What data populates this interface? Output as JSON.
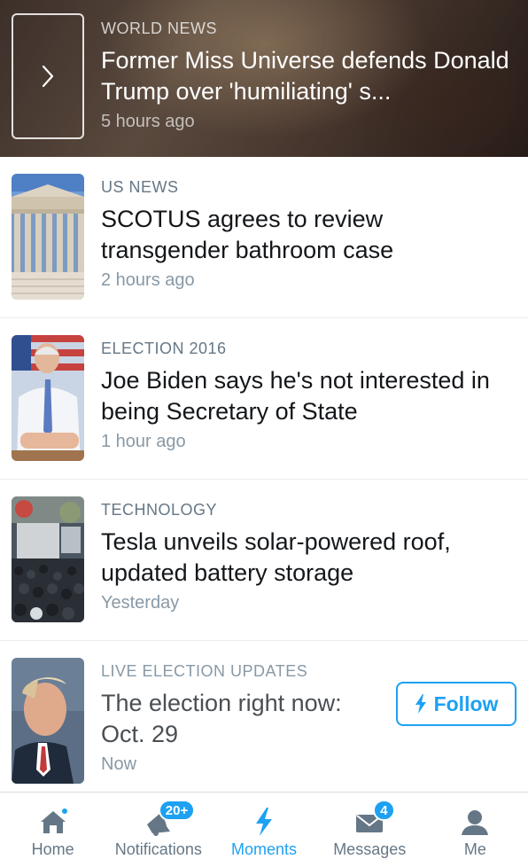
{
  "hero": {
    "category": "WORLD NEWS",
    "headline": "Former Miss Universe defends Donald Trump over 'humiliating' s...",
    "time": "5 hours ago",
    "icon": "chevron-right-icon"
  },
  "stories": [
    {
      "category": "US NEWS",
      "headline": "SCOTUS agrees to review transgender bathroom case",
      "time": "2 hours ago",
      "thumb": "supreme-court-building"
    },
    {
      "category": "ELECTION 2016",
      "headline": "Joe Biden says he's not interested in being Secretary of State",
      "time": "1 hour ago",
      "thumb": "joe-biden-photo"
    },
    {
      "category": "TECHNOLOGY",
      "headline": "Tesla unveils solar-powered roof, updated battery storage",
      "time": "Yesterday",
      "thumb": "tesla-event-crowd"
    },
    {
      "category": "LIVE ELECTION UPDATES",
      "headline": "The election right now: Oct. 29",
      "time": "Now",
      "thumb": "donald-trump-photo",
      "follow_label": "Follow"
    }
  ],
  "tabbar": {
    "active": "Moments",
    "tabs": [
      {
        "label": "Home",
        "icon": "home-icon",
        "indicator": "dot"
      },
      {
        "label": "Notifications",
        "icon": "bell-icon",
        "badge": "20+"
      },
      {
        "label": "Moments",
        "icon": "lightning-icon"
      },
      {
        "label": "Messages",
        "icon": "envelope-icon",
        "badge": "4"
      },
      {
        "label": "Me",
        "icon": "person-icon"
      }
    ]
  },
  "colors": {
    "accent": "#1da1f2",
    "muted": "#657786",
    "text": "#14171a"
  }
}
